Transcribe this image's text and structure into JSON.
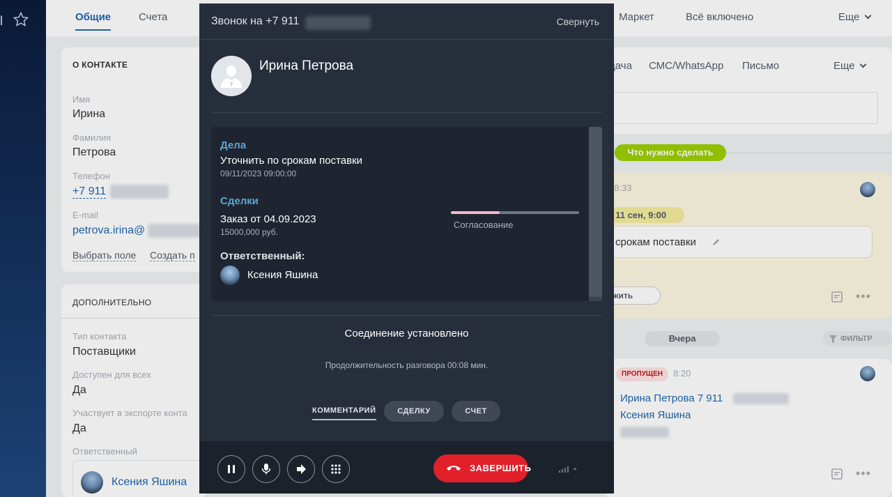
{
  "topbar": {
    "tabs": [
      "Общие",
      "Счета"
    ],
    "tabs_right": [
      "Маркет",
      "Всё включено"
    ],
    "more": "Еще"
  },
  "left_strip": {
    "label": "l"
  },
  "contact": {
    "title": "О КОНТАКТЕ",
    "first_name_label": "Имя",
    "first_name": "Ирина",
    "last_name_label": "Фамилия",
    "last_name": "Петрова",
    "phone_label": "Телефон",
    "phone": "+7 911",
    "email_label": "E-mail",
    "email": "petrova.irina@",
    "choose_field": "Выбрать поле",
    "create_field": "Создать п"
  },
  "additional": {
    "title": "ДОПОЛНИТЕЛЬНО",
    "type_label": "Тип контакта",
    "type_value": "Поставщики",
    "available_label": "Доступен для всех",
    "available_value": "Да",
    "export_label": "Участвует в экспорте конта",
    "export_value": "Да",
    "responsible_label": "Ответственный",
    "responsible_name": "Ксения Яшина"
  },
  "timeline": {
    "tabs": [
      "дача",
      "СМС/WhatsApp",
      "Письмо"
    ],
    "more": "Еще",
    "todo_pill": "Что нужно сделать",
    "item_time": ", 8:33",
    "deadline": ", 11 сен, 9:00",
    "task_text": "срокам поставки",
    "button_partial": "жить",
    "yesterday": "Вчера",
    "filter": "ФИЛЬТР",
    "missed_badge": "ПРОПУЩЕН",
    "missed_time": "8:20",
    "missed_caller": "Ирина Петрова 7 911",
    "missed_responsible": "Ксения Яшина"
  },
  "call": {
    "title": "Звонок на +7 911",
    "collapse": "Свернуть",
    "contact_name": "Ирина Петрова",
    "tasks_header": "Дела",
    "task_title": "Уточнить по срокам поставки",
    "task_date": "09/11/2023 09:00:00",
    "deals_header": "Сделки",
    "deal_title": "Заказ от 04.09.2023",
    "deal_amount": "15000,000 руб.",
    "deal_stage": "Согласование",
    "deal_stage_progress": 0.38,
    "responsible_header": "Ответственный:",
    "responsible_name": "Ксения Яшина",
    "status": "Соединение установлено",
    "duration": "Продолжительность разговора 00:08 мин.",
    "tab_comment": "КОММЕНТАРИЙ",
    "tab_deal": "СДЕЛКУ",
    "tab_invoice": "СЧЕТ",
    "end_button": "ЗАВЕРШИТЬ"
  },
  "colors": {
    "overlay_bg": "#262e3b",
    "accent_blue": "#5ba6d6",
    "end_red": "#e1202a",
    "link_blue": "#2067b0",
    "todo_green": "#9dcf00",
    "missed_red": "#e1202a"
  },
  "icons": [
    "star-icon",
    "person-placeholder-icon",
    "pause-icon",
    "microphone-icon",
    "transfer-arrow-icon",
    "keypad-icon",
    "hangup-phone-icon",
    "signal-icon",
    "pencil-icon",
    "note-icon",
    "more-dots-icon",
    "filter-icon",
    "chevron-down-icon"
  ]
}
